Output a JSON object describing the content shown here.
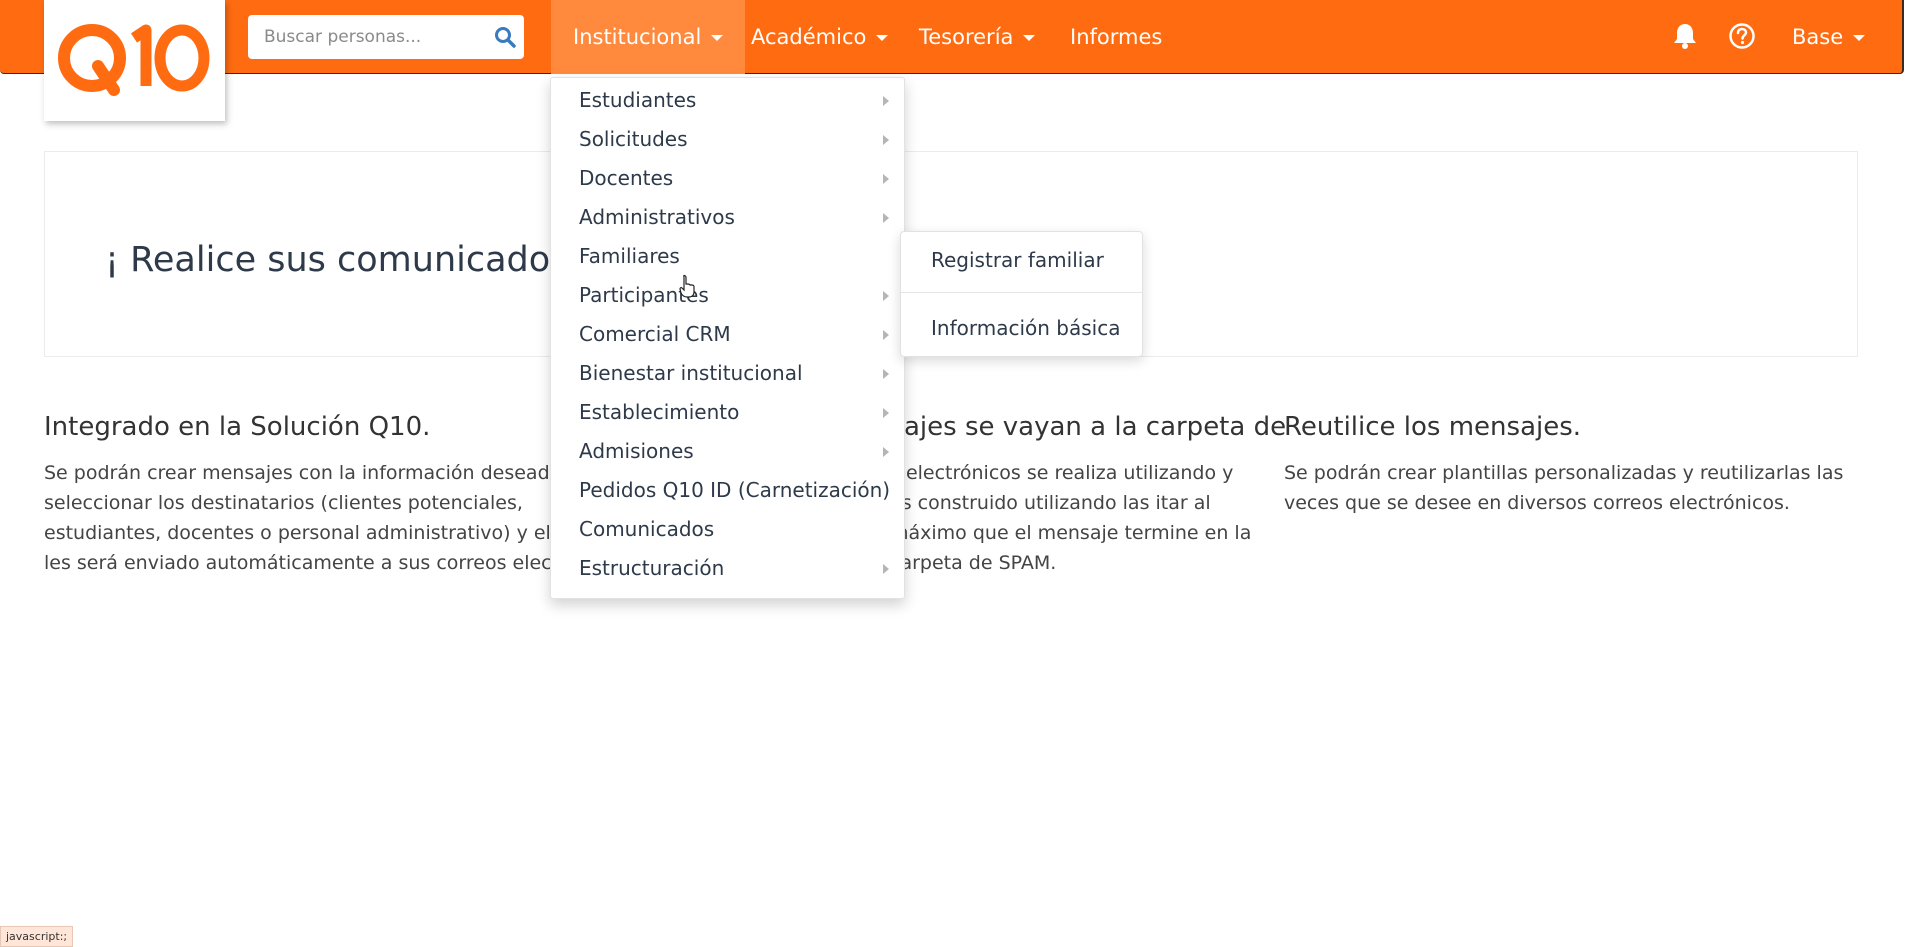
{
  "logo": {
    "text": "Q10"
  },
  "search": {
    "placeholder": "Buscar personas..."
  },
  "nav": {
    "items": [
      {
        "label": "Institucional"
      },
      {
        "label": "Académico"
      },
      {
        "label": "Tesorería"
      },
      {
        "label": "Informes"
      }
    ],
    "user_label": "Base",
    "icons": [
      "bell-icon",
      "question-circle-icon"
    ]
  },
  "colors": {
    "brand": "#ff6b11",
    "nav_active": "#ff8a3d"
  },
  "hero": {
    "title": "¡ Realice sus comunicados d"
  },
  "features": [
    {
      "title": "Integrado en la Solución Q10.",
      "text": "Se podrán crear mensajes con la información deseada, seleccionar los destinatarios (clientes potenciales, estudiantes, docentes o personal administrativo) y el m les será enviado automáticamente a sus correos electr"
    },
    {
      "title": "ajes se vayan a la carpeta de",
      "text": "s electrónicos se realiza utilizando y es construido utilizando las itar al máximo que el mensaje termine en la carpeta de SPAM."
    },
    {
      "title": "Reutilice los mensajes.",
      "text": "Se podrán crear plantillas personalizadas y reutilizarlas las veces que se desee en diversos correos electrónicos."
    }
  ],
  "dropdown": {
    "items": [
      {
        "label": "Estudiantes",
        "has_submenu": true
      },
      {
        "label": "Solicitudes",
        "has_submenu": true
      },
      {
        "label": "Docentes",
        "has_submenu": true
      },
      {
        "label": "Administrativos",
        "has_submenu": true
      },
      {
        "label": "Familiares",
        "has_submenu": false
      },
      {
        "label": "Participantes",
        "has_submenu": true
      },
      {
        "label": "Comercial CRM",
        "has_submenu": true
      },
      {
        "label": "Bienestar institucional",
        "has_submenu": true
      },
      {
        "label": "Establecimiento",
        "has_submenu": true
      },
      {
        "label": "Admisiones",
        "has_submenu": true
      },
      {
        "label": "Pedidos Q10 ID (Carnetización)",
        "has_submenu": false
      },
      {
        "label": "Comunicados",
        "has_submenu": false
      },
      {
        "label": "Estructuración",
        "has_submenu": true
      }
    ]
  },
  "submenu": {
    "items": [
      {
        "label": "Registrar familiar"
      },
      {
        "label": "Información básica"
      }
    ]
  },
  "statusbar": {
    "text": "javascript:;"
  }
}
